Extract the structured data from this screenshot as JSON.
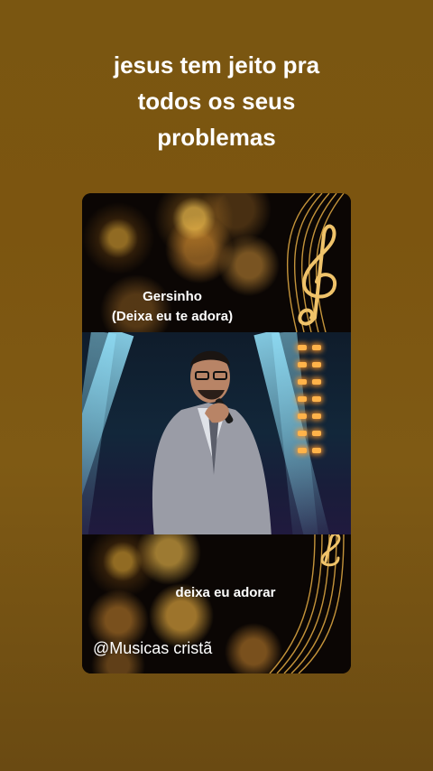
{
  "story": {
    "title_lines": [
      "jesus tem jeito pra",
      "todos os seus",
      "problemas"
    ]
  },
  "card": {
    "artist_name": "Gersinho",
    "song_title": "(Deixa eu te adora)",
    "lyric": "deixa eu adorar",
    "account_handle": "@Musicas cristã"
  },
  "colors": {
    "background": "#7a5611",
    "accent_gold": "#d9a441",
    "text": "#ffffff"
  },
  "icons": [
    "treble-clef-icon",
    "music-staff-decoration"
  ]
}
